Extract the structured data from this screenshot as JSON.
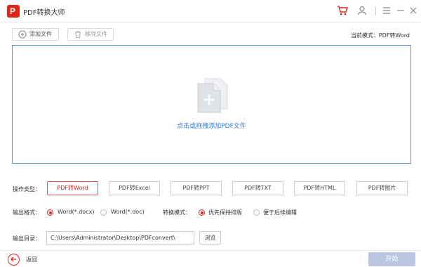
{
  "app": {
    "title": "PDF转换大师",
    "logo_glyph": "P"
  },
  "titlebar_icons": [
    "cart-icon",
    "user-icon",
    "menu-icon",
    "minimize-icon",
    "close-icon"
  ],
  "toolbar": {
    "add_file": "添加文件",
    "remove_file": "移除文件",
    "current_mode": "当前模式：PDF转Word"
  },
  "dropzone": {
    "hint": "点击或拖拽添加PDF文件"
  },
  "operation": {
    "label": "操作类型：",
    "types": [
      "PDF转Word",
      "PDF转Excel",
      "PDF转PPT",
      "PDF转TXT",
      "PDF转HTML",
      "PDF转图片"
    ],
    "active_index": 0
  },
  "output_format": {
    "label": "输出格式：",
    "options": [
      "Word(*.docx)",
      "Word(*.doc)"
    ],
    "selected": "Word(*.docx)"
  },
  "convert_mode": {
    "label": "转换模式：",
    "options": [
      "优先保持排版",
      "便于后续编辑"
    ],
    "selected": "优先保持排版"
  },
  "output_dir": {
    "label": "输出目录：",
    "value": "C:\\Users\\Administrator\\Desktop\\PDFconvert\\",
    "browse": "浏览"
  },
  "footer": {
    "back": "返回",
    "start": "开始"
  },
  "colors": {
    "accent": "#e2231a",
    "link": "#2f7fd6",
    "start_disabled": "#b9c8e0",
    "dropzone_border": "#5b9bd5"
  }
}
